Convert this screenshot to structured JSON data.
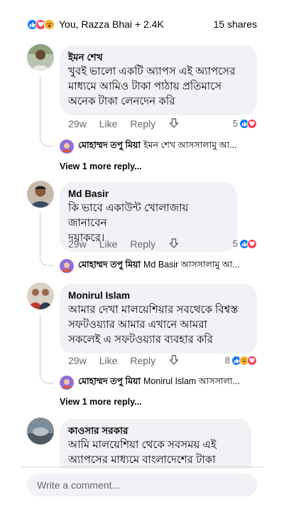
{
  "summary": {
    "reacted_by": "You, Razza Bhai + 2.4K",
    "shares": "15 shares"
  },
  "comments": [
    {
      "author": "ইমন শেখ",
      "text_lines": [
        "খুবই ভালো একটি অ্যাপস এই অ্যাপসের",
        "মাধ্যমে আমিও টাকা পাঠায় প্রতিমাসে",
        "অনেক টাকা লেনদেন করি"
      ],
      "time": "29w",
      "like": "Like",
      "reply": "Reply",
      "reaction_count": "5",
      "reply_preview": {
        "author": "মোহাম্মদ তপু মিয়া",
        "text": "ইমন শেখ আসসালামু আ..."
      },
      "view_more": "View 1 more reply..."
    },
    {
      "author": "Md Basir",
      "text_lines": [
        "কি ভাবে একাউন্ট খোলাজায় জানাবেন",
        "দয়াকরে।"
      ],
      "time": "29w",
      "like": "Like",
      "reply": "Reply",
      "reaction_count": "5",
      "reply_preview": {
        "author": "মোহাম্মদ তপু মিয়া",
        "text": "Md Basir আসসালামু আ..."
      }
    },
    {
      "author": "Monirul Islam",
      "text_lines": [
        "আমার দেখা মালয়েশিয়ার সবথেকে বিশ্বস্ত",
        "সফটওয়্যার আমার এখানে আমরা",
        "সকলেই এ সফটওয়্যার ব্যবহার করি"
      ],
      "time": "29w",
      "like": "Like",
      "reply": "Reply",
      "reaction_count": "8",
      "reply_preview": {
        "author": "মোহাম্মদ তপু মিয়া",
        "text": "Monirul Islam আসসালা..."
      },
      "view_more": "View 1 more reply..."
    },
    {
      "author": "কাওসার সরকার",
      "text_lines": [
        "আমি মালয়েশিয়া থেকে সবসময় এই",
        "অ্যাপসের মাধ্যমে বাংলাদেশের টাকা"
      ]
    }
  ],
  "composer": {
    "placeholder": "Write a comment..."
  },
  "colors": {
    "like_blue": "#1877f2",
    "love_red": "#f33e58",
    "wow_yellow": "#f7b125",
    "bubble_bg": "#f0f2f5",
    "meta_gray": "#65676b"
  },
  "icons": [
    "like-icon",
    "love-icon",
    "wow-icon",
    "haha-icon",
    "downvote-arrow-icon"
  ]
}
